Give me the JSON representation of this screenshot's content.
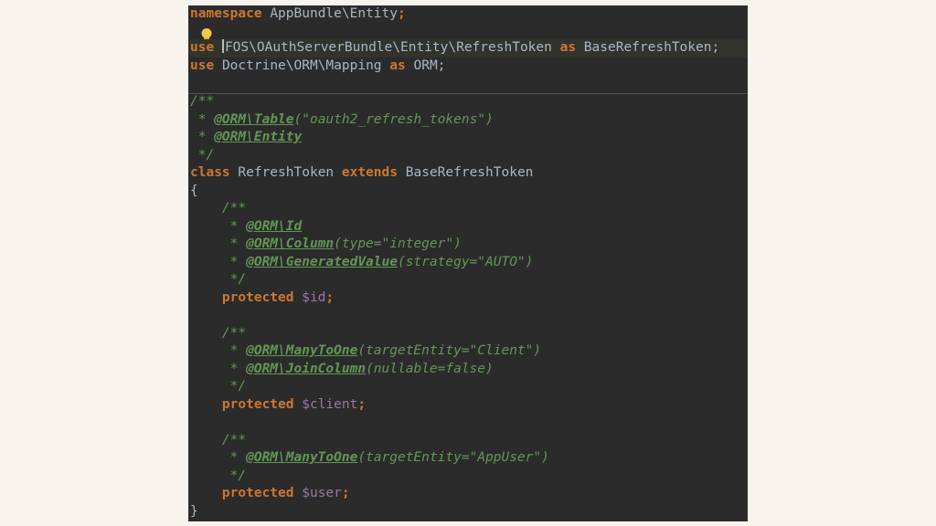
{
  "editor": {
    "namespace_kw": "namespace",
    "namespace_name": "AppBundle\\Entity",
    "use1_kw": "use",
    "use1_path": "FOS\\OAuthServerBundle\\Entity\\RefreshToken",
    "use1_as": "as",
    "use1_alias": "BaseRefreshToken;",
    "use2_kw": "use",
    "use2_path": "Doctrine\\ORM\\Mapping",
    "use2_as": "as",
    "use2_alias": "ORM;",
    "doc_open": "/**",
    "doc_star": " * ",
    "doc_close": " */",
    "table_ann": "@ORM\\Table",
    "table_args": "(\"oauth2_refresh_tokens\")",
    "entity_ann": "@ORM\\Entity",
    "class_kw": "class",
    "class_name": "RefreshToken",
    "extends_kw": "extends",
    "parent_name": "BaseRefreshToken",
    "brace_open": "{",
    "brace_close": "}",
    "ind_doc_open": "    /**",
    "ind_doc_star": "     * ",
    "ind_doc_close": "     */",
    "id_ann": "@ORM\\Id",
    "column_ann": "@ORM\\Column",
    "column_args": "(type=\"integer\")",
    "generated_ann": "@ORM\\GeneratedValue",
    "generated_args": "(strategy=\"AUTO\")",
    "protected_kw": "protected",
    "id_var": "$id",
    "semicolon": ";",
    "many_to_one_ann": "@ORM\\ManyToOne",
    "client_target_args": "(targetEntity=\"Client\")",
    "join_column_ann": "@ORM\\JoinColumn",
    "join_column_args": "(nullable=false)",
    "client_var": "$client",
    "user_target_args": "(targetEntity=\"AppUser\")",
    "user_var": "$user"
  }
}
